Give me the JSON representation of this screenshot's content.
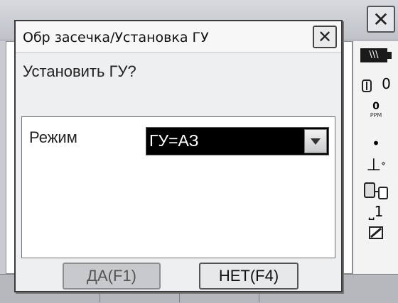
{
  "background": {
    "close_symbol": "✕",
    "status": {
      "battery": "\\\\\\",
      "number": "0",
      "ppm_value": "0",
      "ppm_label": "PPM",
      "tilt_symbol": "⊥",
      "page_number": "1"
    }
  },
  "dialog": {
    "title": "Обр засечка/Установка ГУ",
    "close_symbol": "✕",
    "question": "Установить ГУ?",
    "mode_label": "Режим",
    "mode_value": "ГУ=АЗ",
    "yes_button": "ДА(F1)",
    "no_button": "НЕТ(F4)"
  }
}
